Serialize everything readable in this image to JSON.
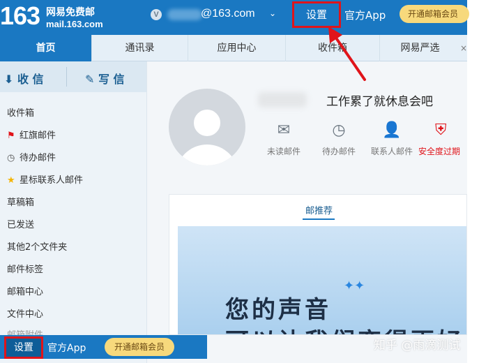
{
  "header": {
    "logo_number": "163",
    "logo_text": "网易免费邮",
    "logo_domain": "mail.163.com",
    "vip_badge": "V",
    "account": "@163.com",
    "settings_label": "设置",
    "app_label": "官方App",
    "vip_button": "开通邮箱会员"
  },
  "nav": {
    "tabs": [
      "首页",
      "通讯录",
      "应用中心",
      "收件箱",
      "网易严选"
    ],
    "more": "×"
  },
  "sidebar": {
    "receive_label": "收 信",
    "write_label": "写 信",
    "folders": [
      {
        "label": "收件箱",
        "icon": ""
      },
      {
        "label": "红旗邮件",
        "icon": "flag-icon"
      },
      {
        "label": "待办邮件",
        "icon": "clock-icon"
      },
      {
        "label": "星标联系人邮件",
        "icon": "star-icon"
      },
      {
        "label": "草稿箱",
        "icon": ""
      },
      {
        "label": "已发送",
        "icon": ""
      },
      {
        "label": "其他2个文件夹",
        "icon": ""
      },
      {
        "label": "邮件标签",
        "icon": ""
      },
      {
        "label": "邮箱中心",
        "icon": ""
      },
      {
        "label": "文件中心",
        "icon": ""
      },
      {
        "label": "邮箱附件",
        "icon": ""
      }
    ]
  },
  "bottom_bar": {
    "settings_label": "设置",
    "app_label": "官方App",
    "vip_button": "开通邮箱会员"
  },
  "main": {
    "greeting": "工作累了就休息会吧",
    "stats": [
      {
        "label": "未读邮件",
        "icon": "envelope-icon"
      },
      {
        "label": "待办邮件",
        "icon": "clock-icon"
      },
      {
        "label": "联系人邮件",
        "icon": "contact-star-icon"
      },
      {
        "label": "安全度过期",
        "icon": "shield-icon"
      }
    ],
    "card_tab": "邮推荐",
    "banner_line1": "您的声音",
    "banner_line2": "可以让我们变得更好"
  },
  "watermark": "知乎 @雨滴测试",
  "colors": {
    "brand_blue": "#1a78c2",
    "annotation_red": "#e0141a",
    "vip_gold": "#f7d97c"
  }
}
